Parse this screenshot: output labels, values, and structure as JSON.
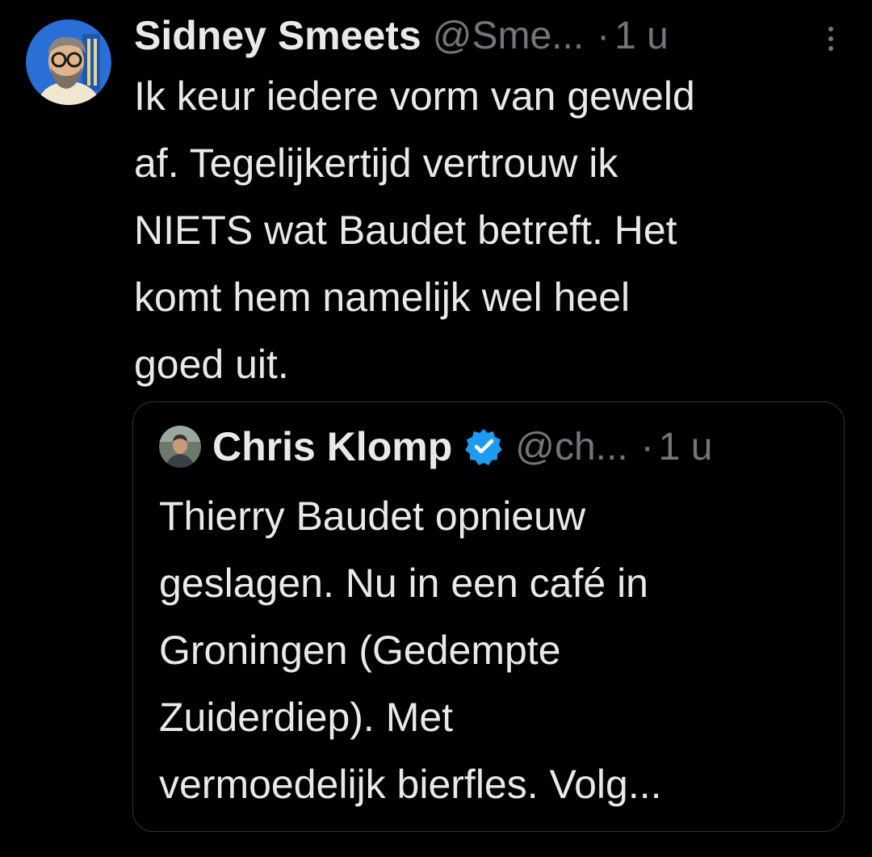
{
  "tweet": {
    "author": {
      "display_name": "Sidney Smeets",
      "handle": "@Sme...",
      "avatar_icon": "bearded-man-glasses-avatar"
    },
    "separator": "·",
    "time": "1 u",
    "more_icon": "vertical-ellipsis-icon",
    "text_lines": [
      "Ik keur iedere vorm van geweld",
      "af. Tegelijkertijd vertrouw ik",
      "NIETS wat Baudet betreft. Het",
      "komt hem namelijk wel heel",
      "goed uit."
    ]
  },
  "quoted_tweet": {
    "author": {
      "display_name": "Chris Klomp",
      "handle": "@ch...",
      "verified": true,
      "verified_icon": "verified-badge-icon",
      "avatar_icon": "person-photo-avatar"
    },
    "separator": "·",
    "time": "1 u",
    "text_lines": [
      "Thierry Baudet opnieuw",
      "geslagen. Nu in een café in",
      "Groningen  (Gedempte",
      "Zuiderdiep). Met",
      "vermoedelijk bierfles. Volg..."
    ]
  },
  "colors": {
    "background": "#000000",
    "text_primary": "#e7e9ea",
    "text_secondary": "#71767b",
    "border": "#2f3336",
    "verified_blue": "#1d9bf0"
  }
}
